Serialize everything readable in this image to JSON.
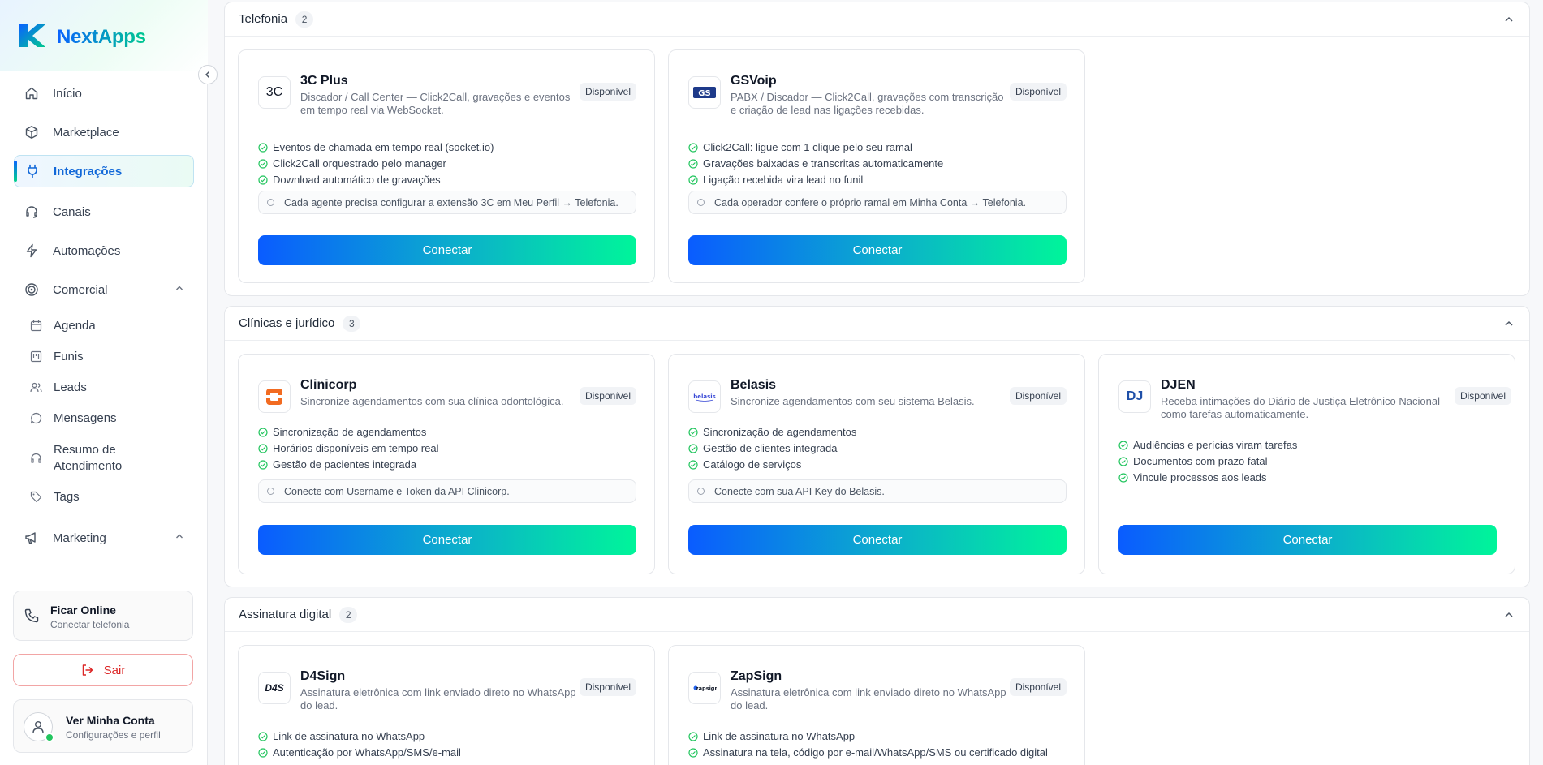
{
  "brand": {
    "name": "NextApps"
  },
  "nav": {
    "inicio": "Início",
    "marketplace": "Marketplace",
    "integracoes": "Integrações",
    "canais": "Canais",
    "automacoes": "Automações",
    "comercial": "Comercial",
    "marketing": "Marketing"
  },
  "comercial_items": {
    "agenda": "Agenda",
    "funis": "Funis",
    "leads": "Leads",
    "mensagens": "Mensagens",
    "resumo_l1": "Resumo de",
    "resumo_l2": "Atendimento",
    "tags": "Tags"
  },
  "online": {
    "title": "Ficar Online",
    "subtitle": "Conectar telefonia"
  },
  "logout": "Sair",
  "account": {
    "title": "Ver Minha Conta",
    "subtitle": "Configurações e perfil"
  },
  "sections": [
    {
      "title": "Telefonia",
      "count": "2",
      "cards": [
        {
          "name": "3C Plus",
          "logo": "3C",
          "desc": "Discador / Call Center — Click2Call, gravações e eventos em tempo real via WebSocket.",
          "status": "Disponível",
          "features": [
            "Eventos de chamada em tempo real (socket.io)",
            "Click2Call orquestrado pelo manager",
            "Download automático de gravações"
          ],
          "note": "Cada agente precisa configurar a extensão 3C em Meu Perfil → Telefonia.",
          "button": "Conectar"
        },
        {
          "name": "GSVoip",
          "logo": "GS",
          "desc": "PABX / Discador — Click2Call, gravações com transcrição e criação de lead nas ligações recebidas.",
          "status": "Disponível",
          "features": [
            "Click2Call: ligue com 1 clique pelo seu ramal",
            "Gravações baixadas e transcritas automaticamente",
            "Ligação recebida vira lead no funil"
          ],
          "note": "Cada operador confere o próprio ramal em Minha Conta → Telefonia.",
          "button": "Conectar"
        }
      ]
    },
    {
      "title": "Clínicas e jurídico",
      "count": "3",
      "cards": [
        {
          "name": "Clinicorp",
          "logo": "",
          "desc": "Sincronize agendamentos com sua clínica odontológica.",
          "status": "Disponível",
          "features": [
            "Sincronização de agendamentos",
            "Horários disponíveis em tempo real",
            "Gestão de pacientes integrada"
          ],
          "note": "Conecte com Username e Token da API Clinicorp.",
          "button": "Conectar"
        },
        {
          "name": "Belasis",
          "logo": "belasis",
          "desc": "Sincronize agendamentos com seu sistema Belasis.",
          "status": "Disponível",
          "features": [
            "Sincronização de agendamentos",
            "Gestão de clientes integrada",
            "Catálogo de serviços"
          ],
          "note": "Conecte com sua API Key do Belasis.",
          "button": "Conectar"
        },
        {
          "name": "DJEN",
          "logo": "DJ",
          "desc": "Receba intimações do Diário de Justiça Eletrônico Nacional como tarefas automaticamente.",
          "status": "Disponível",
          "features": [
            "Audiências e perícias viram tarefas",
            "Documentos com prazo fatal",
            "Vincule processos aos leads"
          ],
          "button": "Conectar"
        }
      ]
    },
    {
      "title": "Assinatura digital",
      "count": "2",
      "cards": [
        {
          "name": "D4Sign",
          "logo": "D4S",
          "desc": "Assinatura eletrônica com link enviado direto no WhatsApp do lead.",
          "status": "Disponível",
          "features": [
            "Link de assinatura no WhatsApp",
            "Autenticação por WhatsApp/SMS/e-mail"
          ]
        },
        {
          "name": "ZapSign",
          "logo": "zapsign",
          "desc": "Assinatura eletrônica com link enviado direto no WhatsApp do lead.",
          "status": "Disponível",
          "features": [
            "Link de assinatura no WhatsApp",
            "Assinatura na tela, código por e-mail/WhatsApp/SMS ou certificado digital"
          ]
        }
      ]
    }
  ],
  "colors": {
    "accent_blue": "#0a5cff",
    "accent_green": "#00f59a",
    "check_green": "#22c55e",
    "danger": "#dc2626"
  }
}
